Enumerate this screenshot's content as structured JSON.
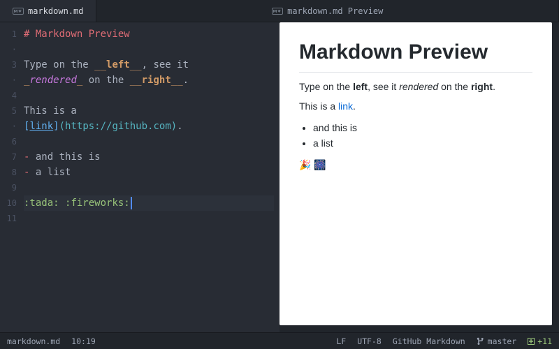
{
  "tabs": {
    "editor": "markdown.md",
    "preview": "markdown.md Preview"
  },
  "editor": {
    "line_numbers": [
      "1",
      "·",
      "3",
      "·",
      "4",
      "5",
      "·",
      "6",
      "7",
      "8",
      "9",
      "10",
      "11"
    ],
    "lines": [
      [
        [
          "tok-h",
          "# Markdown Preview"
        ]
      ],
      [
        [
          "",
          ""
        ]
      ],
      [
        [
          "",
          "Type on the "
        ],
        [
          "tok-pb",
          "__"
        ],
        [
          "tok-b",
          "left"
        ],
        [
          "tok-pb",
          "__"
        ],
        [
          "",
          ", see it"
        ]
      ],
      [
        [
          "tok-pb",
          "_"
        ],
        [
          "tok-i",
          "rendered"
        ],
        [
          "tok-pb",
          "_"
        ],
        [
          "",
          " on the "
        ],
        [
          "tok-pb",
          "__"
        ],
        [
          "tok-b",
          "right"
        ],
        [
          "tok-pb",
          "__"
        ],
        [
          "",
          "."
        ]
      ],
      [
        [
          "",
          ""
        ]
      ],
      [
        [
          "",
          "This is a"
        ]
      ],
      [
        [
          "tok-lb",
          "["
        ],
        [
          "tok-lt",
          "link"
        ],
        [
          "tok-lb",
          "]"
        ],
        [
          "tok-lu",
          "("
        ],
        [
          "tok-lu",
          "https://github.com"
        ],
        [
          "tok-lu",
          ")"
        ],
        [
          "",
          "."
        ]
      ],
      [
        [
          "",
          ""
        ]
      ],
      [
        [
          "tok-lm",
          "-"
        ],
        [
          "",
          " and this is"
        ]
      ],
      [
        [
          "tok-lm",
          "-"
        ],
        [
          "",
          " a list"
        ]
      ],
      [
        [
          "",
          ""
        ]
      ],
      [
        [
          "tok-em",
          ":tada:"
        ],
        [
          "",
          " "
        ],
        [
          "tok-em",
          ":fireworks:"
        ]
      ],
      [
        [
          "",
          ""
        ]
      ]
    ],
    "active_line_index": 11
  },
  "preview": {
    "h1": "Markdown Preview",
    "p1_parts": [
      "Type on the ",
      "left",
      ", see it ",
      "rendered",
      " on the ",
      "right",
      "."
    ],
    "p2_pre": "This is a ",
    "p2_link": "link",
    "p2_post": ".",
    "list": [
      "and this is",
      "a list"
    ],
    "emoji": "🎉 🎆"
  },
  "status": {
    "filename": "markdown.md",
    "cursor": "10:19",
    "line_ending": "LF",
    "encoding": "UTF-8",
    "grammar": "GitHub Markdown",
    "branch": "master",
    "diff": "+11"
  }
}
